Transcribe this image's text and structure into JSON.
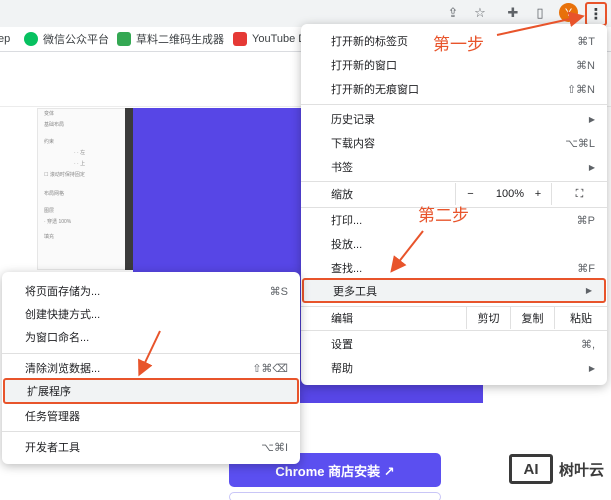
{
  "toolbar": {
    "avatar_letter": "Y",
    "icons": [
      "share-icon",
      "star-icon",
      "extensions-icon",
      "sidepanel-icon",
      "kebab-menu-icon"
    ]
  },
  "bookmarks": [
    {
      "label": "ep",
      "color": "#ffffff"
    },
    {
      "label": "微信公众平台",
      "color": "#07c160"
    },
    {
      "label": "草料二维码生成器",
      "color": "#34a853"
    },
    {
      "label": "YouTube D",
      "color": "#e53935"
    }
  ],
  "main_menu": {
    "items": [
      {
        "label": "打开新的标签页",
        "shortcut": "⌘T"
      },
      {
        "label": "打开新的窗口",
        "shortcut": "⌘N"
      },
      {
        "label": "打开新的无痕窗口",
        "shortcut": "⇧⌘N"
      },
      {
        "label": "历史记录",
        "shortcut": "▶"
      },
      {
        "label": "下载内容",
        "shortcut": "⌥⌘L"
      },
      {
        "label": "书签",
        "shortcut": "▶"
      },
      {
        "label": "打印...",
        "shortcut": "⌘P"
      },
      {
        "label": "投放...",
        "shortcut": ""
      },
      {
        "label": "查找...",
        "shortcut": "⌘F"
      },
      {
        "label": "更多工具",
        "shortcut": "▶"
      },
      {
        "label": "设置",
        "shortcut": "⌘,"
      },
      {
        "label": "帮助",
        "shortcut": "▶"
      }
    ],
    "zoom": {
      "label": "缩放",
      "minus": "−",
      "value": "100%",
      "plus": "+",
      "fullscreen": "⛶"
    },
    "edit": {
      "label": "编辑",
      "cut": "剪切",
      "copy": "复制",
      "paste": "粘贴"
    }
  },
  "sub_menu": {
    "items": [
      {
        "label": "将页面存储为...",
        "shortcut": "⌘S"
      },
      {
        "label": "创建快捷方式...",
        "shortcut": ""
      },
      {
        "label": "为窗口命名...",
        "shortcut": ""
      },
      {
        "label": "清除浏览数据...",
        "shortcut": "⇧⌘⌫"
      },
      {
        "label": "扩展程序",
        "shortcut": ""
      },
      {
        "label": "任务管理器",
        "shortcut": ""
      },
      {
        "label": "开发者工具",
        "shortcut": "⌥⌘I"
      }
    ]
  },
  "page": {
    "store_button": "Chrome 商店安装 ↗",
    "panel_rows": [
      "变体",
      "基础布局",
      "约束",
      "· · 左",
      "· · 上",
      "☐ 滚动时保持固定",
      "布局网格",
      "图层",
      "· 穿透  100%",
      "填充"
    ]
  },
  "annotations": {
    "step1": "第一步",
    "step2": "第二步",
    "color": "#e8542b"
  },
  "watermark": {
    "logo": "AI",
    "text": "树叶云"
  }
}
